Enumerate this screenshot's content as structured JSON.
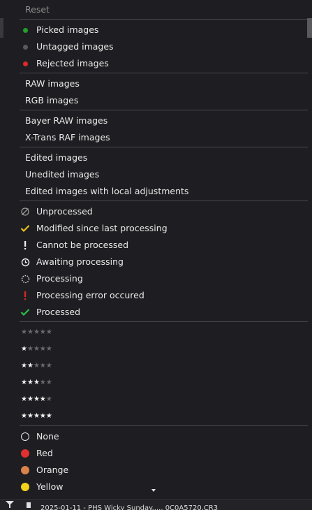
{
  "menu": {
    "reset": "Reset",
    "group1": [
      {
        "label": "Picked images",
        "dot_color": "#1fa12a"
      },
      {
        "label": "Untagged images",
        "dot_color": "#5a5a5a"
      },
      {
        "label": "Rejected images",
        "dot_color": "#e02828"
      }
    ],
    "group2": [
      {
        "label": "RAW images"
      },
      {
        "label": "RGB images"
      }
    ],
    "group3": [
      {
        "label": "Bayer RAW images"
      },
      {
        "label": "X-Trans RAF images"
      }
    ],
    "group4": [
      {
        "label": "Edited images"
      },
      {
        "label": "Unedited images"
      },
      {
        "label": "Edited images with local adjustments"
      }
    ],
    "group5": [
      {
        "label": "Unprocessed",
        "icon": "unprocessed-icon"
      },
      {
        "label": "Modified since last processing",
        "icon": "checkmark-icon"
      },
      {
        "label": "Cannot be processed",
        "icon": "exclamation-icon"
      },
      {
        "label": "Awaiting processing",
        "icon": "clock-icon"
      },
      {
        "label": "Processing",
        "icon": "spinner-icon"
      },
      {
        "label": "Processing error occured",
        "icon": "error-exclamation-icon"
      },
      {
        "label": "Processed",
        "icon": "processed-check-icon"
      }
    ],
    "ratings": [
      0,
      1,
      2,
      3,
      4,
      5
    ],
    "colors": [
      {
        "label": "None",
        "color": ""
      },
      {
        "label": "Red",
        "color": "#e03030"
      },
      {
        "label": "Orange",
        "color": "#d9834a"
      },
      {
        "label": "Yellow",
        "color": "#f2d21a"
      }
    ],
    "accent": {
      "check_yellow": "#e8c020",
      "check_green": "#2bc04a",
      "error_red": "#e02828"
    }
  },
  "status": {
    "text": "2025-01-11 - PHS Wicky Sunday..... 0C0A5720.CR3"
  }
}
